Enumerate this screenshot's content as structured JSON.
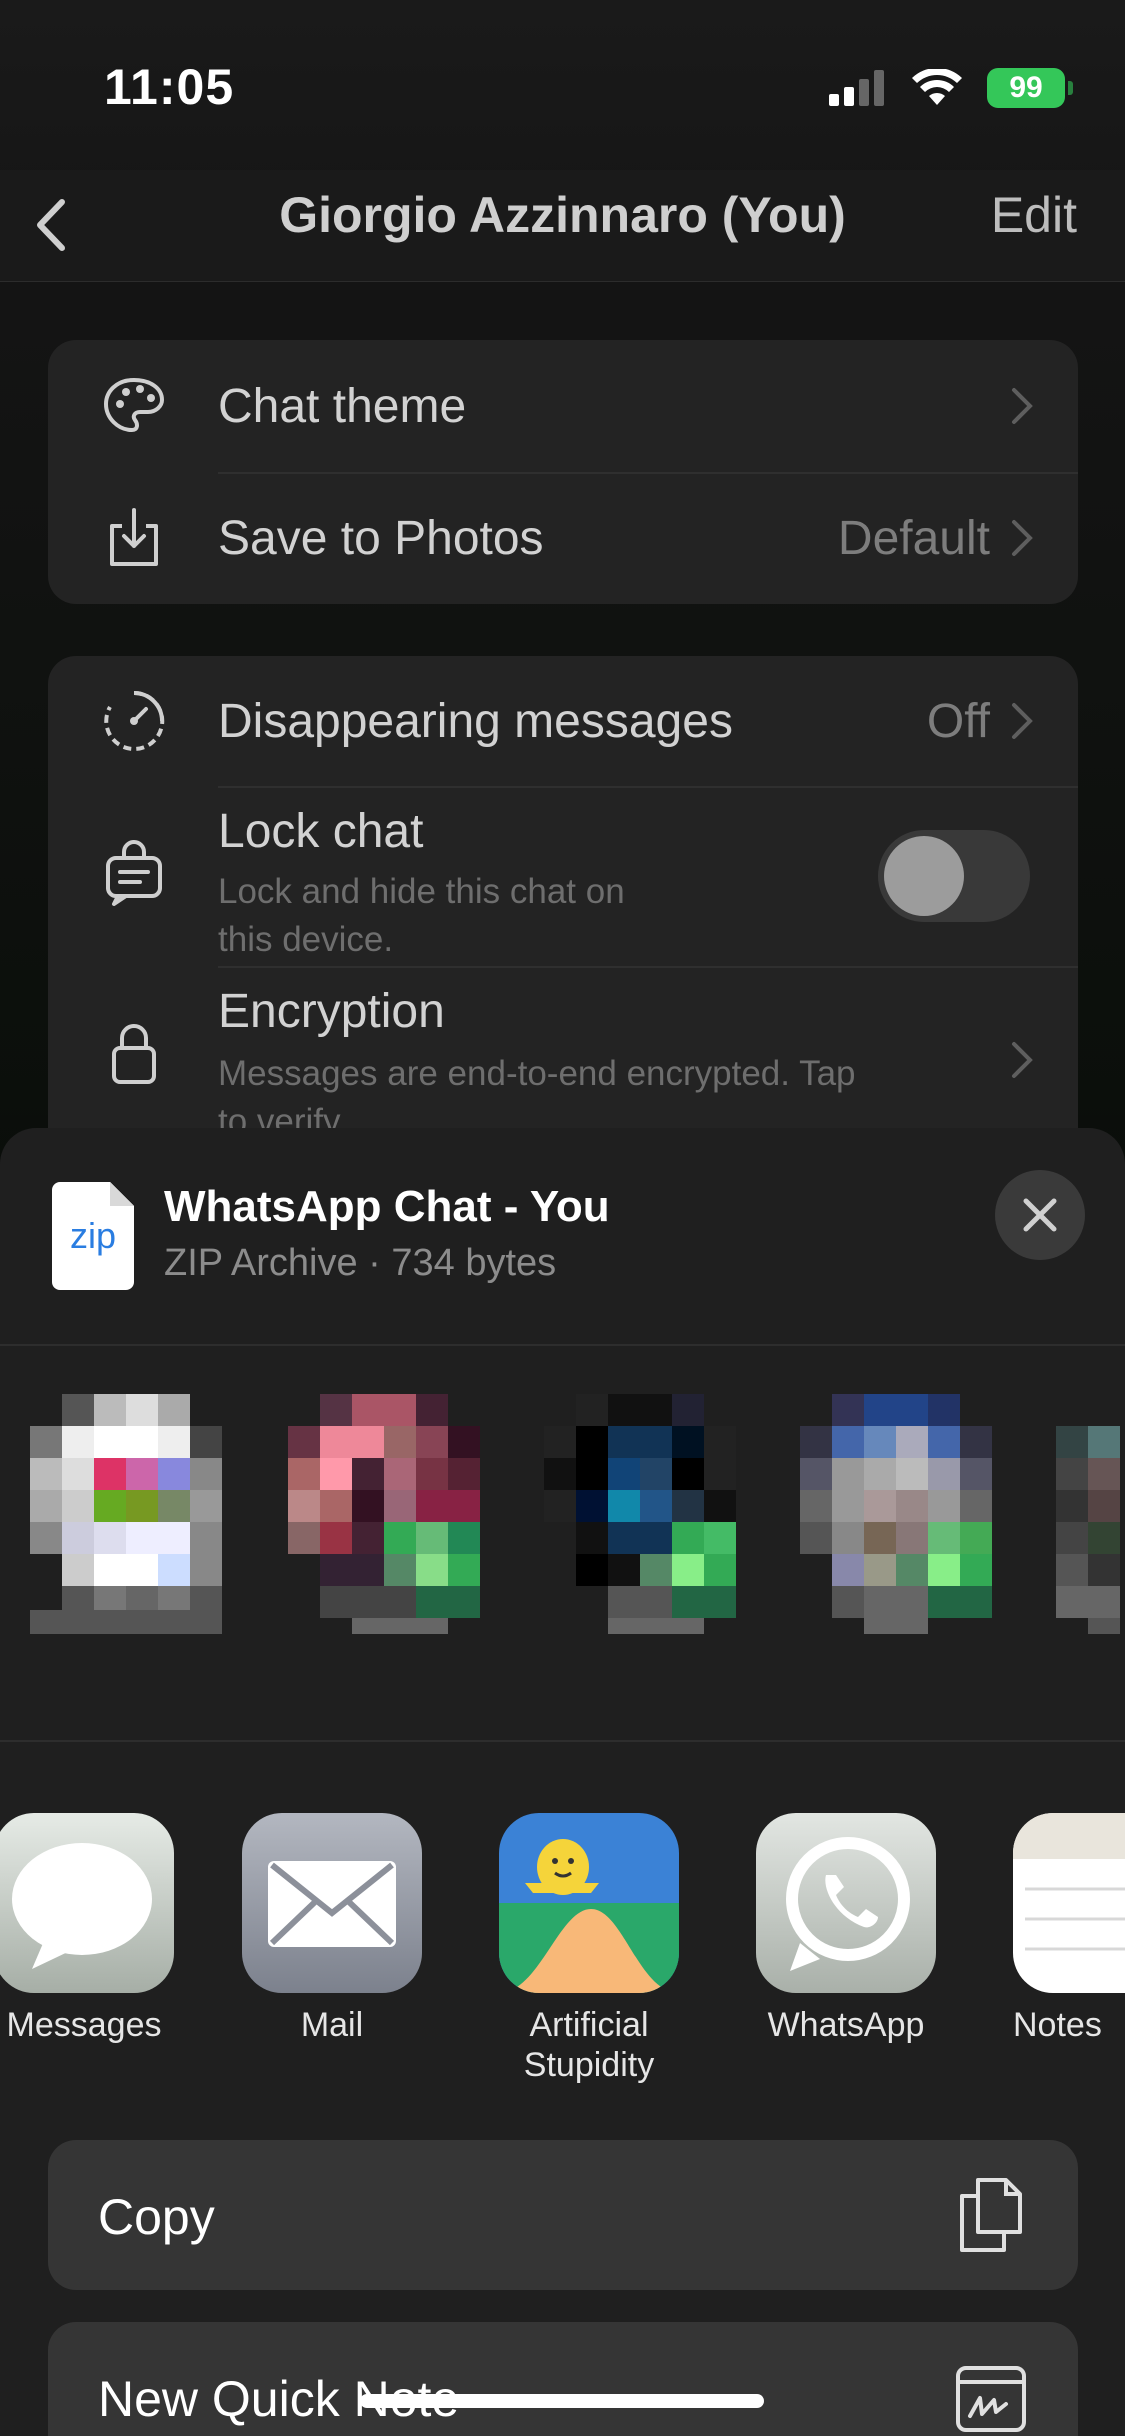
{
  "status_bar": {
    "time": "11:05",
    "battery": "99"
  },
  "nav": {
    "title": "Giorgio Azzinnaro (You)",
    "edit": "Edit"
  },
  "settings_group_1": [
    {
      "label": "Chat theme",
      "value": ""
    },
    {
      "label": "Save to Photos",
      "value": "Default"
    }
  ],
  "settings_group_2": {
    "disappearing": {
      "label": "Disappearing messages",
      "value": "Off"
    },
    "lock": {
      "label": "Lock chat",
      "sub_line1": "Lock and hide this chat on",
      "sub_line2": "this device.",
      "enabled": false
    },
    "encryption": {
      "label": "Encryption",
      "sub_line1": "Messages are end-to-end encrypted. Tap",
      "sub_line2": "to verify."
    }
  },
  "share_sheet": {
    "file": {
      "icon_text": "zip",
      "title": "WhatsApp Chat - You",
      "subtitle": "ZIP Archive · 734 bytes"
    },
    "apps": [
      {
        "name": "Messages",
        "icon": "messages-icon"
      },
      {
        "name": "Mail",
        "icon": "mail-icon"
      },
      {
        "name_line1": "Artificial",
        "name_line2": "Stupidity",
        "icon": "artificial-stupidity-icon"
      },
      {
        "name": "WhatsApp",
        "icon": "whatsapp-icon"
      },
      {
        "name": "Notes",
        "icon": "notes-icon"
      }
    ],
    "actions": [
      {
        "label": "Copy",
        "icon": "copy-icon"
      },
      {
        "label": "New Quick Note",
        "icon": "quick-note-icon"
      }
    ]
  },
  "colors": {
    "battery": "#34c759",
    "whatsapp": "#25d366"
  }
}
